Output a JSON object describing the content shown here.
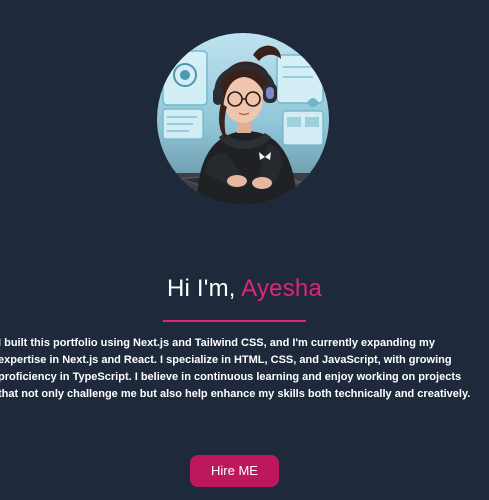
{
  "hero": {
    "avatar_alt": "Ayesha avatar",
    "greeting_prefix": "Hi I'm, ",
    "name": "Ayesha",
    "bio": "I built this portfolio using Next.js and Tailwind CSS, and I'm currently expanding my expertise in Next.js and React. I specialize in HTML, CSS, and JavaScript, with growing proficiency in TypeScript. I believe in continuous learning and enjoy working on projects that not only challenge me but also help enhance my skills both technically and creatively.",
    "cta_label": "Hire ME"
  },
  "colors": {
    "background": "#1e293b",
    "accent": "#db2777",
    "button": "#be185d",
    "text": "#ffffff"
  }
}
